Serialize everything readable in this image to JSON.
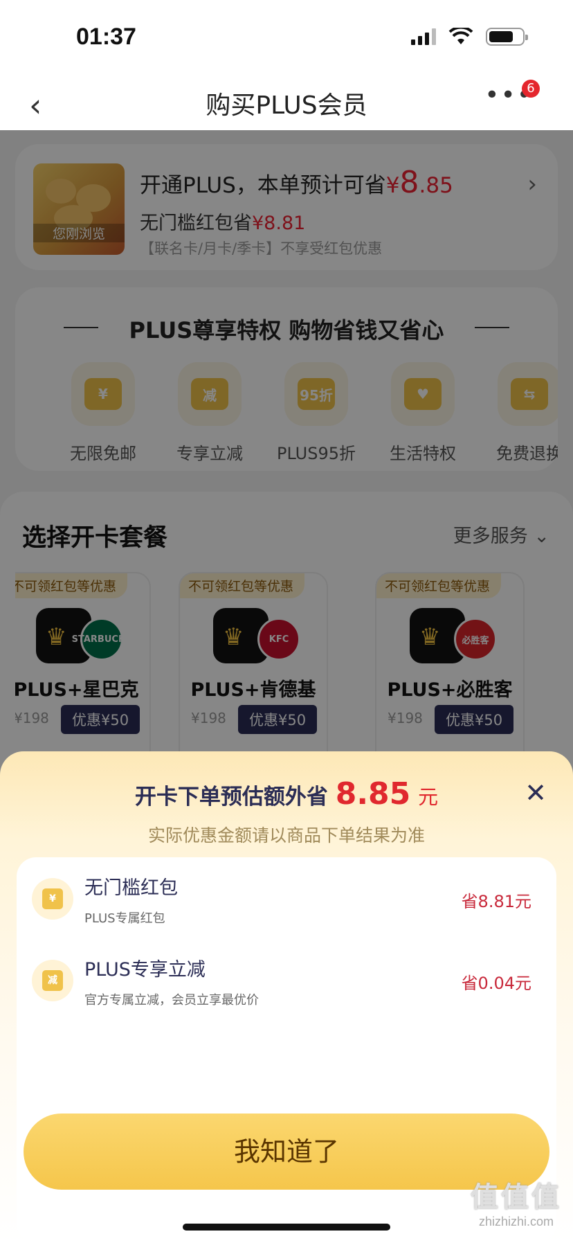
{
  "status_bar": {
    "time": "01:37"
  },
  "nav": {
    "back": "‹",
    "title": "购买PLUS会员",
    "more": "•••",
    "badge": "6"
  },
  "product_card": {
    "thumb_label": "您刚浏览",
    "line1_prefix": "开通PLUS，本单预计可省",
    "line1_currency": "¥",
    "line1_amount_int": "8",
    "line1_amount_dec": ".85",
    "line2_prefix": "无门槛红包省",
    "line2_price": "¥8.81",
    "line3": "【联名卡/月卡/季卡】不享受红包优惠",
    "arrow": "›"
  },
  "privileges": {
    "title": "PLUS尊享特权 购物省钱又省心",
    "items": [
      {
        "label": "无限免邮",
        "icon_text": "¥"
      },
      {
        "label": "专享立减",
        "icon_text": "减"
      },
      {
        "label": "PLUS95折",
        "icon_text": "95折"
      },
      {
        "label": "生活特权",
        "icon_text": "♥"
      },
      {
        "label": "免费退换",
        "icon_text": "⇆"
      }
    ]
  },
  "plans": {
    "title": "选择开卡套餐",
    "more": "更多服务 ⌄",
    "items": [
      {
        "tag": "不可领红包等优惠",
        "name": "PLUS+星巴克",
        "orig": "¥198",
        "discount": "优惠¥50",
        "partner": "STARBUCKS",
        "partner_color": "#00704a"
      },
      {
        "tag": "不可领红包等优惠",
        "name": "PLUS+肯德基",
        "orig": "¥198",
        "discount": "优惠¥50",
        "partner": "KFC",
        "partner_color": "#c8102e"
      },
      {
        "tag": "不可领红包等优惠",
        "name": "PLUS+必胜客",
        "orig": "¥198",
        "discount": "优惠¥50",
        "partner": "必胜客",
        "partner_color": "#d9252b"
      }
    ]
  },
  "sheet": {
    "title_prefix": "开卡下单预估额外省",
    "amount": "8.85",
    "unit": "元",
    "close": "✕",
    "subtitle": "实际优惠金额请以商品下单结果为准",
    "benefits": [
      {
        "title": "无门槛红包",
        "desc": "PLUS专属红包",
        "save": "省8.81元",
        "icon_text": "¥"
      },
      {
        "title": "PLUS专享立减",
        "desc": "官方专属立减，会员立享最优价",
        "save": "省0.04元",
        "icon_text": "减"
      }
    ],
    "confirm": "我知道了"
  },
  "watermark": {
    "big": "值值值",
    "small": "zhizhizhi.com"
  }
}
